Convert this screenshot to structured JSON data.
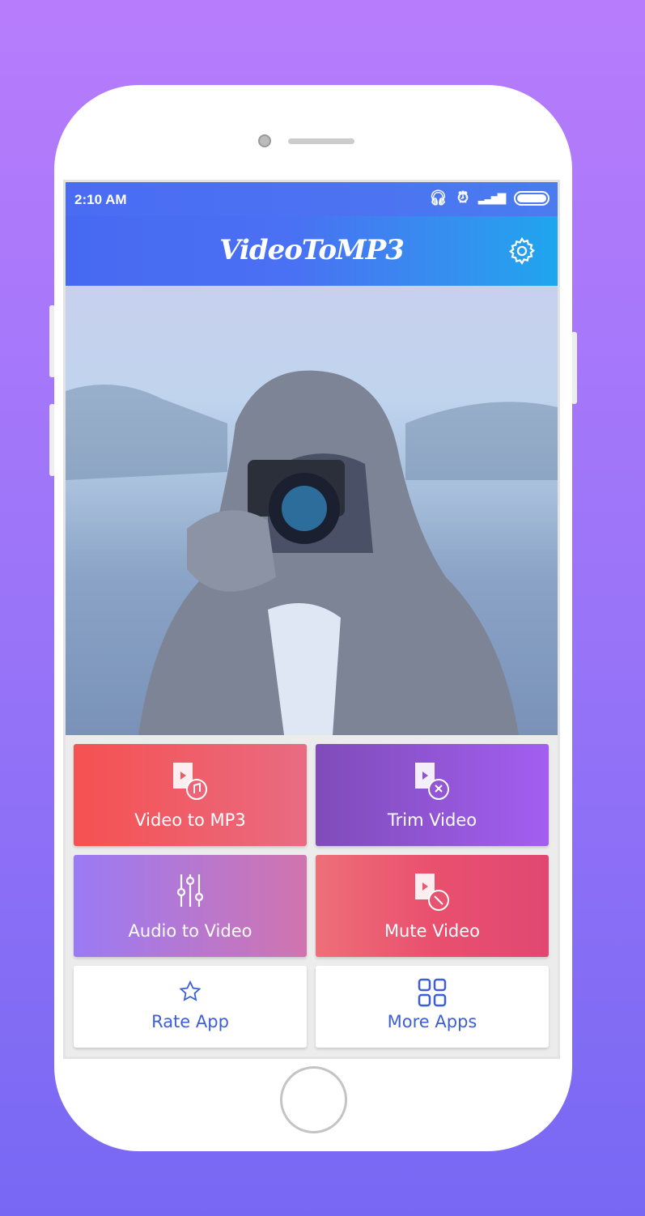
{
  "status_bar": {
    "time": "2:10 AM",
    "icons": [
      "headphones-icon",
      "alarm-icon",
      "signal-icon",
      "battery-icon"
    ]
  },
  "header": {
    "title": "VideoToMP3",
    "settings_icon": "gear-icon"
  },
  "tiles": [
    {
      "label": "Video to MP3",
      "icon": "video-music-icon",
      "colors": [
        "#f55252",
        "#e9697f"
      ]
    },
    {
      "label": "Trim Video",
      "icon": "video-scissors-icon",
      "colors": [
        "#7f4dbb",
        "#a35ff0"
      ]
    },
    {
      "label": "Audio to Video",
      "icon": "sliders-icon",
      "colors": [
        "#9b7bf4",
        "#d073b0"
      ]
    },
    {
      "label": "Mute Video",
      "icon": "video-mute-icon",
      "colors": [
        "#ef6f78",
        "#e14773"
      ]
    },
    {
      "label": "Rate App",
      "icon": "star-icon"
    },
    {
      "label": "More Apps",
      "icon": "grid-icon"
    }
  ]
}
